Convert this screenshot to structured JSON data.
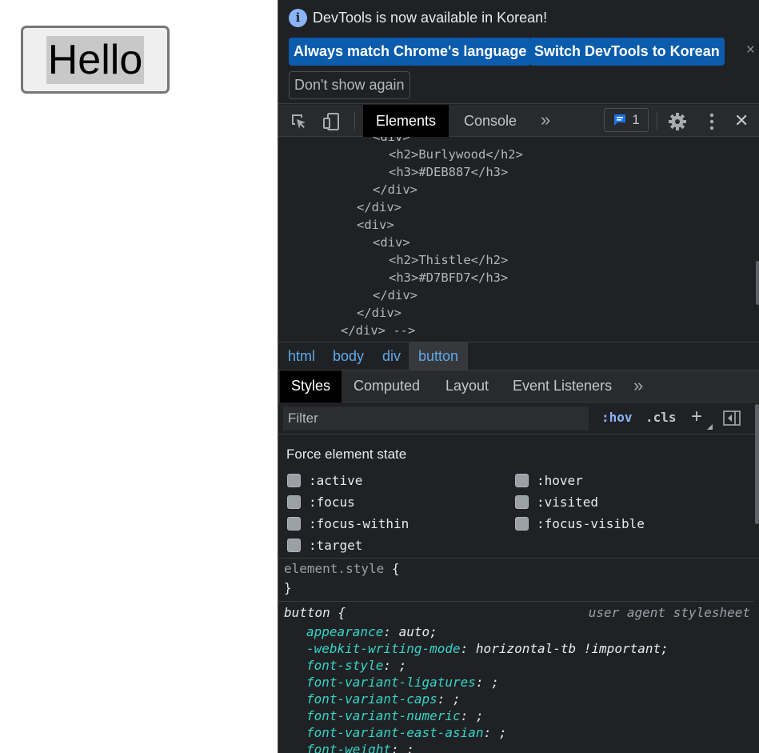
{
  "page": {
    "button_label": "Hello"
  },
  "infobar": {
    "message": "DevTools is now available in Korean!",
    "btn_match": "Always match Chrome's language",
    "btn_switch": "Switch DevTools to Korean",
    "btn_dont_show": "Don't show again",
    "close": "×"
  },
  "toolbar": {
    "tab_elements": "Elements",
    "tab_console": "Console",
    "more_tabs": "»",
    "issues_count": "1",
    "close": "✕"
  },
  "dom": {
    "lines": [
      "<div>",
      "<h2>Burlywood</h2>",
      "<h3>#DEB887</h3>",
      "</div>",
      "</div>",
      "<div>",
      "<div>",
      "<h2>Thistle</h2>",
      "<h3>#D7BFD7</h3>",
      "</div>",
      "</div>",
      "</div> -->"
    ]
  },
  "breadcrumbs": [
    "html",
    "body",
    "div",
    "button"
  ],
  "styles_tabs": {
    "styles": "Styles",
    "computed": "Computed",
    "layout": "Layout",
    "event_listeners": "Event Listeners",
    "more": "»"
  },
  "filter": {
    "placeholder": "Filter",
    "hov": ":hov",
    "cls": ".cls",
    "plus": "+"
  },
  "force_state": {
    "title": "Force element state",
    "states": [
      ":active",
      ":hover",
      ":focus",
      ":visited",
      ":focus-within",
      ":focus-visible",
      ":target"
    ]
  },
  "rules": {
    "element_style_selector": "element.style",
    "open_brace": "{",
    "close_brace": "}",
    "button_selector": "button {",
    "ua_label": "user agent stylesheet",
    "declarations": [
      {
        "prop": "appearance",
        "value": ": auto;"
      },
      {
        "prop": "-webkit-writing-mode",
        "value": ": horizontal-tb !important;"
      },
      {
        "prop": "font-style",
        "value": ": ;"
      },
      {
        "prop": "font-variant-ligatures",
        "value": ": ;"
      },
      {
        "prop": "font-variant-caps",
        "value": ": ;"
      },
      {
        "prop": "font-variant-numeric",
        "value": ": ;"
      },
      {
        "prop": "font-variant-east-asian",
        "value": ": ;"
      },
      {
        "prop": "font-weight",
        "value": ": ;"
      }
    ]
  },
  "colors": {
    "accent": "#8ab4f8",
    "primary_button": "#0b5cad",
    "css_property": "#35d4c7",
    "breadcrumb_link": "#5ea9e8"
  }
}
